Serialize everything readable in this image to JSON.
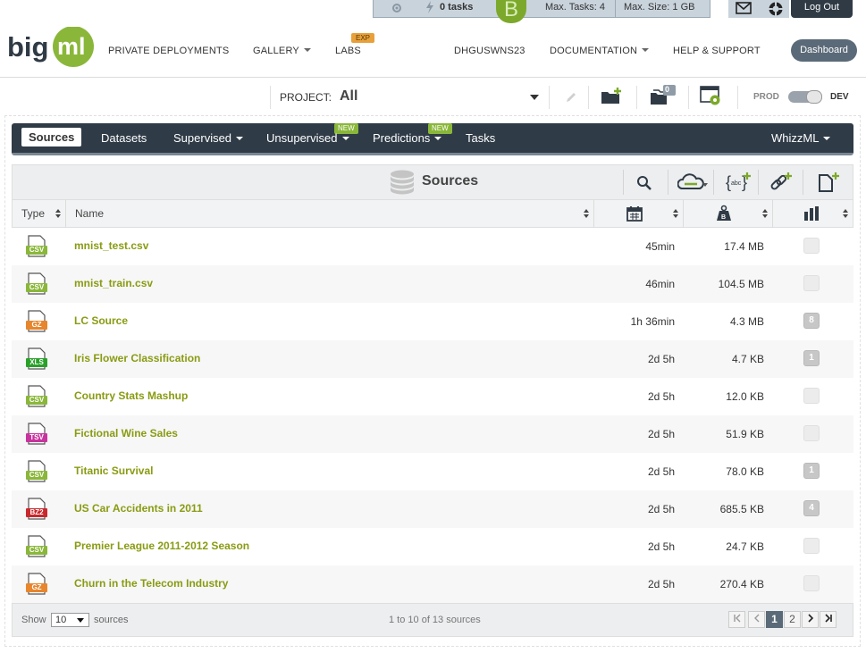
{
  "statusbar": {
    "tasks": "0 tasks",
    "max_tasks": "Max. Tasks: 4",
    "max_size": "Max. Size: 1 GB",
    "badge_letter": "B"
  },
  "header": {
    "logout": "Log Out",
    "nav": [
      {
        "label": "PRIVATE DEPLOYMENTS",
        "caret": false
      },
      {
        "label": "GALLERY",
        "caret": true
      },
      {
        "label": "LABS",
        "caret": false,
        "badge": "EXP"
      },
      {
        "label": "DHGUSWNS23",
        "caret": false
      },
      {
        "label": "DOCUMENTATION",
        "caret": true
      },
      {
        "label": "HELP & SUPPORT",
        "caret": false
      }
    ],
    "dashboard": "Dashboard"
  },
  "project": {
    "label": "PROJECT:",
    "value": "All",
    "folder_count": "0",
    "prod": "PROD",
    "dev": "DEV"
  },
  "tabs": [
    {
      "label": "Sources",
      "active": true
    },
    {
      "label": "Datasets"
    },
    {
      "label": "Supervised",
      "caret": true
    },
    {
      "label": "Unsupervised",
      "caret": true,
      "badge": "NEW"
    },
    {
      "label": "Predictions",
      "caret": true,
      "badge": "NEW"
    },
    {
      "label": "Tasks"
    },
    {
      "label": "WhizzML",
      "caret": true
    }
  ],
  "list": {
    "title": "Sources",
    "columns": {
      "type": "Type",
      "name": "Name"
    },
    "rows": [
      {
        "type": "CSV",
        "name": "mnist_test.csv",
        "age": "45min",
        "size": "17.4 MB",
        "count": ""
      },
      {
        "type": "CSV",
        "name": "mnist_train.csv",
        "age": "46min",
        "size": "104.5 MB",
        "count": ""
      },
      {
        "type": "GZ",
        "name": "LC Source",
        "age": "1h 36min",
        "size": "4.3 MB",
        "count": "8"
      },
      {
        "type": "XLS",
        "name": "Iris Flower Classification",
        "age": "2d 5h",
        "size": "4.7 KB",
        "count": "1"
      },
      {
        "type": "CSV",
        "name": "Country Stats Mashup",
        "age": "2d 5h",
        "size": "12.0 KB",
        "count": ""
      },
      {
        "type": "TSV",
        "name": "Fictional Wine Sales",
        "age": "2d 5h",
        "size": "51.9 KB",
        "count": ""
      },
      {
        "type": "CSV",
        "name": "Titanic Survival",
        "age": "2d 5h",
        "size": "78.0 KB",
        "count": "1"
      },
      {
        "type": "BZ2",
        "name": "US Car Accidents in 2011",
        "age": "2d 5h",
        "size": "685.5 KB",
        "count": "4"
      },
      {
        "type": "CSV",
        "name": "Premier League 2011-2012 Season",
        "age": "2d 5h",
        "size": "24.7 KB",
        "count": ""
      },
      {
        "type": "GZ",
        "name": "Churn in the Telecom Industry",
        "age": "2d 5h",
        "size": "270.4 KB",
        "count": ""
      }
    ]
  },
  "footer": {
    "show": "Show",
    "page_size": "10",
    "sources": "sources",
    "range": "1 to 10 of 13 sources",
    "pages": [
      "1",
      "2"
    ],
    "current_page": "1"
  },
  "colors": {
    "accent_green": "#8a9b12",
    "tabbar": "#2f3b47",
    "csv": "#8ab73a",
    "gz": "#e7862d",
    "xls": "#29a129",
    "tsv": "#c8349e",
    "bz2": "#c9282d"
  }
}
